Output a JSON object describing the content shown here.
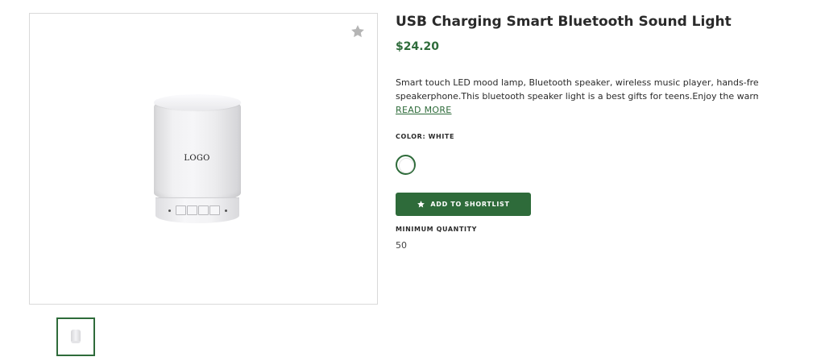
{
  "product": {
    "title": "USB Charging Smart Bluetooth Sound Light",
    "price": "$24.20",
    "description_line1": "Smart touch LED mood lamp, Bluetooth speaker, wireless music player, hands-free",
    "description_line2": "speakerphone.This bluetooth speaker light is a best gifts for teens.Enjoy the warm...",
    "read_more": "READ MORE",
    "color_label": "COLOR: WHITE",
    "selected_color": "#ffffff",
    "add_button_label": "ADD TO SHORTLIST",
    "min_quantity_label": "MINIMUM QUANTITY",
    "min_quantity_value": "50"
  },
  "gallery": {
    "image_logo_text": "LOGO",
    "favorite_icon": "star-icon"
  },
  "theme": {
    "accent": "#2e6b3a",
    "star_inactive": "#b5b5b5"
  }
}
